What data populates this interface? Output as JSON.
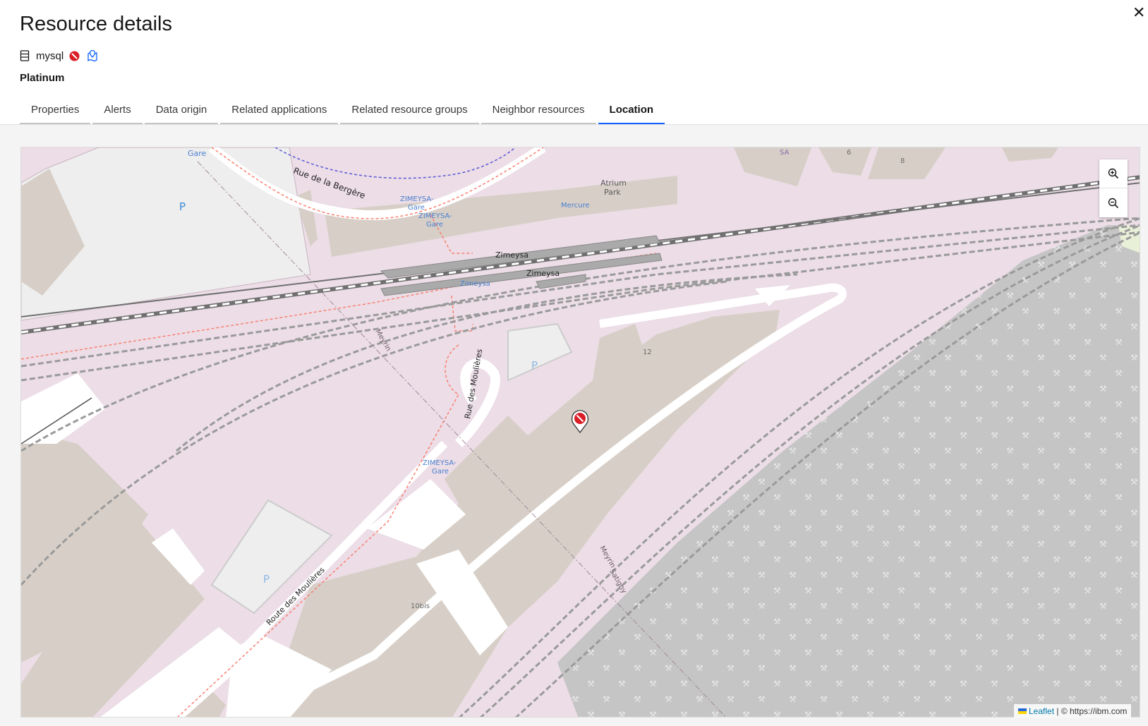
{
  "panel": {
    "title": "Resource details",
    "close_icon": "✕"
  },
  "resource": {
    "name": "mysql",
    "tier": "Platinum",
    "status_color": "#da1e28"
  },
  "tabs": [
    {
      "label": "Properties"
    },
    {
      "label": "Alerts"
    },
    {
      "label": "Data origin"
    },
    {
      "label": "Related applications"
    },
    {
      "label": "Related resource groups"
    },
    {
      "label": "Neighbor resources"
    },
    {
      "label": "Location",
      "active": true
    }
  ],
  "map": {
    "labels": {
      "gare_top": "Gare",
      "rue_bergere": "Rue de la Bergère",
      "zimeysa_gare_1": "ZIMEYSA-",
      "gare_1": "Gare",
      "zimeysa_gare_2": "ZIMEYSA-",
      "gare_2": "Gare",
      "atrium_1": "Atrium",
      "atrium_2": "Park",
      "mercure": "Mercure",
      "zimeysa_a": "Zimeysa",
      "zimeysa_b": "Zimeysa",
      "zimeysa_c": "Zimeysa",
      "meyrin_1": "Meyrin",
      "rue_moulieres": "Rue des Moulières",
      "num_12": "12",
      "zimeysa_gare_3": "ZIMEYSA-",
      "gare_3": "Gare",
      "route_moulieres": "Route des Moulières",
      "num_10bis": "10bis",
      "meyrin_2": "Meyrin",
      "satigny": "Satigny",
      "sa": "SA",
      "num_6": "6",
      "num_8": "8",
      "parking": "P"
    },
    "attribution": {
      "leaflet": "Leaflet",
      "separator": " | ",
      "copyright": "© https://ibm.com"
    }
  },
  "colors": {
    "accent": "#0f62fe",
    "critical": "#da1e28"
  }
}
